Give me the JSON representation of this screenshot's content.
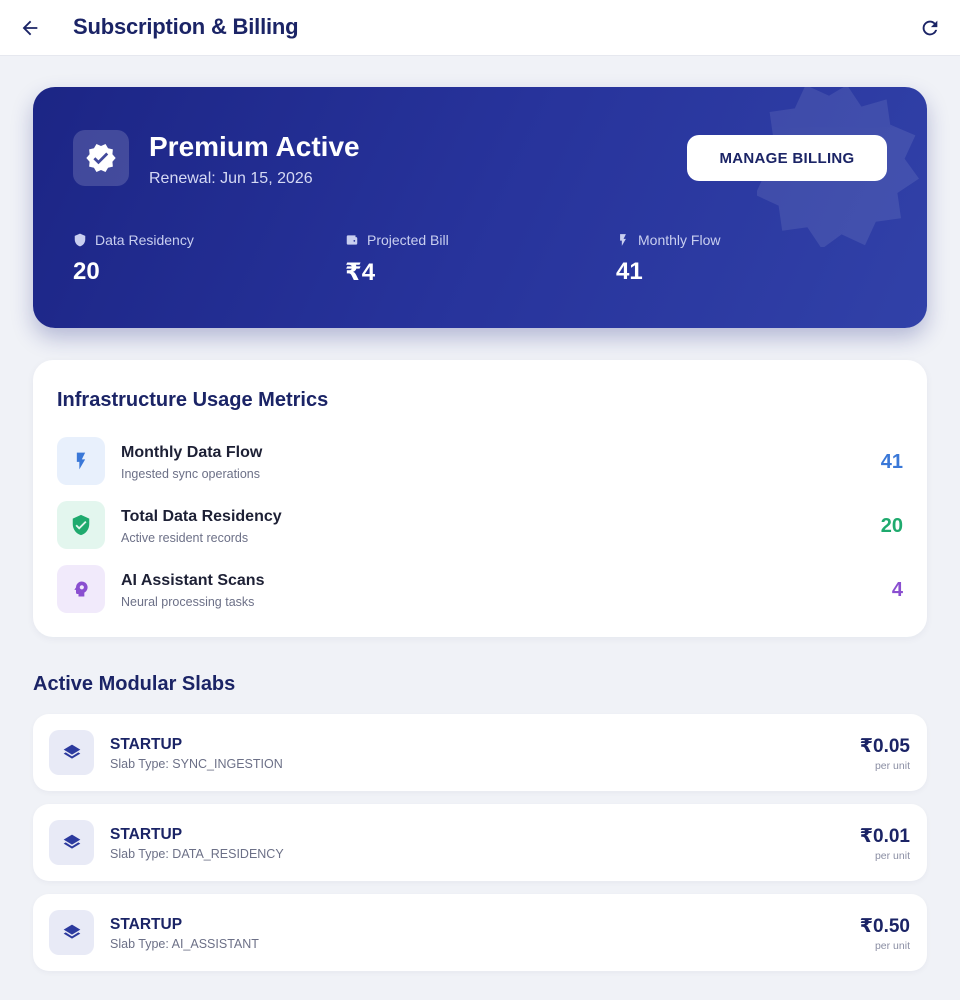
{
  "header": {
    "title": "Subscription & Billing",
    "back_icon": "arrow-back-icon",
    "refresh_icon": "refresh-icon"
  },
  "hero": {
    "plan_title": "Premium Active",
    "renewal": "Renewal: Jun 15, 2026",
    "manage_button": "MANAGE BILLING",
    "stats": [
      {
        "label": "Data Residency",
        "value": "20",
        "icon": "shield-icon"
      },
      {
        "label": "Projected Bill",
        "value": "₹4",
        "icon": "wallet-icon"
      },
      {
        "label": "Monthly Flow",
        "value": "41",
        "icon": "bolt-icon"
      }
    ],
    "colors": {
      "gradient_start": "#1c2585",
      "gradient_end": "#3141a8"
    }
  },
  "usage": {
    "heading": "Infrastructure Usage Metrics",
    "metrics": [
      {
        "name": "Monthly Data Flow",
        "sub": "Ingested sync operations",
        "value": "41",
        "icon": "bolt-icon",
        "color": "#3a78d8"
      },
      {
        "name": "Total Data Residency",
        "sub": "Active resident records",
        "value": "20",
        "icon": "shield-check-icon",
        "color": "#1faa6e"
      },
      {
        "name": "AI Assistant Scans",
        "sub": "Neural processing tasks",
        "value": "4",
        "icon": "brain-head-icon",
        "color": "#8a4fd0"
      }
    ]
  },
  "slabs": {
    "heading": "Active Modular Slabs",
    "items": [
      {
        "tier": "STARTUP",
        "type": "Slab Type: SYNC_INGESTION",
        "price": "₹0.05",
        "unit": "per unit",
        "icon": "layers-icon"
      },
      {
        "tier": "STARTUP",
        "type": "Slab Type: DATA_RESIDENCY",
        "price": "₹0.01",
        "unit": "per unit",
        "icon": "layers-icon"
      },
      {
        "tier": "STARTUP",
        "type": "Slab Type: AI_ASSISTANT",
        "price": "₹0.50",
        "unit": "per unit",
        "icon": "layers-icon"
      }
    ]
  }
}
